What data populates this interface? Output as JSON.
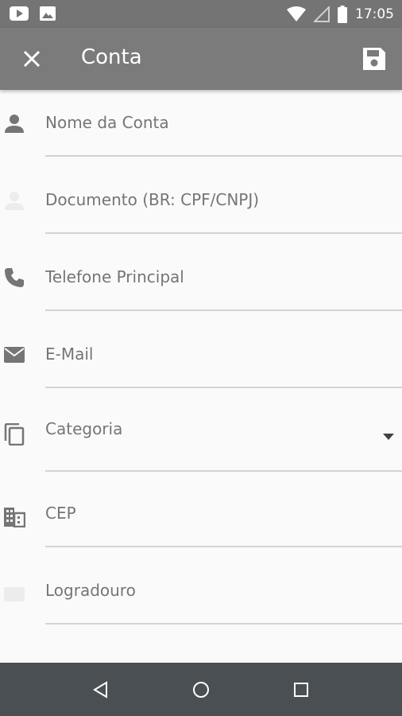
{
  "status_bar": {
    "time": "17:05"
  },
  "app_bar": {
    "title": "Conta"
  },
  "form": {
    "fields": [
      {
        "placeholder": "Nome da Conta",
        "icon": "person-icon"
      },
      {
        "placeholder": "Documento (BR: CPF/CNPJ)",
        "icon": "person-faded-icon"
      },
      {
        "placeholder": "Telefone Principal",
        "icon": "phone-icon"
      },
      {
        "placeholder": "E-Mail",
        "icon": "email-icon"
      },
      {
        "placeholder": "CEP",
        "icon": "business-icon"
      },
      {
        "placeholder": "Logradouro",
        "icon": "address-faded-icon"
      }
    ],
    "category": {
      "label": "Categoria",
      "icon": "copy-icon"
    }
  },
  "colors": {
    "app_bar": "#7b7b7b",
    "status_bar": "#747474",
    "nav_bar": "#4a4f53",
    "icon": "#757575",
    "underline": "#d3d3d3"
  }
}
